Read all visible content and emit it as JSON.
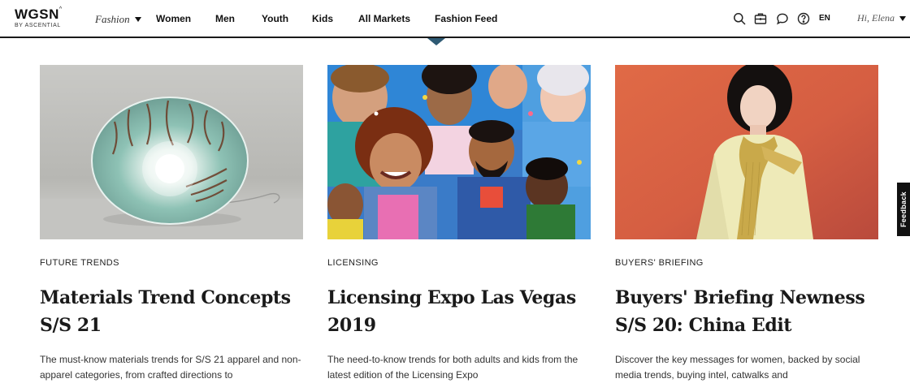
{
  "brand": {
    "name": "WGSN",
    "mark": "^",
    "sub": "BY ASCENTIAL"
  },
  "nav": {
    "section": "Fashion",
    "items": [
      "Women",
      "Men",
      "Youth",
      "Kids",
      "All Markets",
      "Fashion Feed"
    ],
    "icons": [
      "search-icon",
      "briefcase-icon",
      "chat-icon",
      "help-icon"
    ],
    "language": "EN",
    "greeting": "Hi, Elena"
  },
  "cards": [
    {
      "tag": "FUTURE TRENDS",
      "title": "Materials Trend Concepts S/S 21",
      "description": "The must-know materials trends for S/S 21 apparel and non-apparel categories, from crafted directions to",
      "image": "glass-bowl-lamp"
    },
    {
      "tag": "LICENSING",
      "title": "Licensing Expo Las Vegas 2019",
      "description": "The need-to-know trends for both adults and kids from the latest edition of the Licensing Expo",
      "image": "group-of-people"
    },
    {
      "tag": "BUYERS' BRIEFING",
      "title": "Buyers' Briefing Newness S/S 20: China Edit",
      "description": "Discover the key messages for women, backed by social media trends, buying intel, catwalks and",
      "image": "model-portrait"
    }
  ],
  "feedback": "Feedback",
  "colors": {
    "accent": "#2e5a74",
    "text": "#1a1a1a",
    "feedback_bg": "#111111"
  }
}
